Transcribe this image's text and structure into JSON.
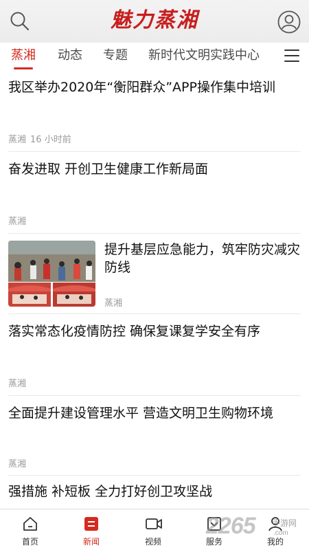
{
  "header": {
    "logo_text": "魅力蒸湘"
  },
  "tabs": [
    {
      "label": "蒸湘",
      "active": true
    },
    {
      "label": "动态",
      "active": false
    },
    {
      "label": "专题",
      "active": false
    },
    {
      "label": "新时代文明实践中心",
      "active": false
    }
  ],
  "articles": [
    {
      "title": "我区举办2020年“衡阳群众”APP操作集中培训",
      "source": "蒸湘",
      "time": "16 小时前"
    },
    {
      "title": "奋发进取 开创卫生健康工作新局面",
      "source": "蒸湘"
    },
    {
      "title": "提升基层应急能力，筑牢防灾减灾防线",
      "source": "蒸湘",
      "has_image": true
    },
    {
      "title": "落实常态化疫情防控 确保复课复学安全有序",
      "source": "蒸湘"
    },
    {
      "title": "全面提升建设管理水平 营造文明卫生购物环境",
      "source": "蒸湘"
    },
    {
      "title": "强措施 补短板 全力打好创卫攻坚战",
      "source": ""
    }
  ],
  "bottom_nav": [
    {
      "label": "首页",
      "icon": "home-icon",
      "active": false
    },
    {
      "label": "新闻",
      "icon": "news-icon",
      "active": true
    },
    {
      "label": "视频",
      "icon": "video-icon",
      "active": false
    },
    {
      "label": "服务",
      "icon": "service-icon",
      "active": false
    },
    {
      "label": "我的",
      "icon": "profile-icon",
      "active": false
    }
  ],
  "watermark": {
    "number": "2265",
    "sub": "手游网",
    "url": ".com"
  },
  "colors": {
    "accent": "#d42a20",
    "logo": "#c81e1e"
  }
}
